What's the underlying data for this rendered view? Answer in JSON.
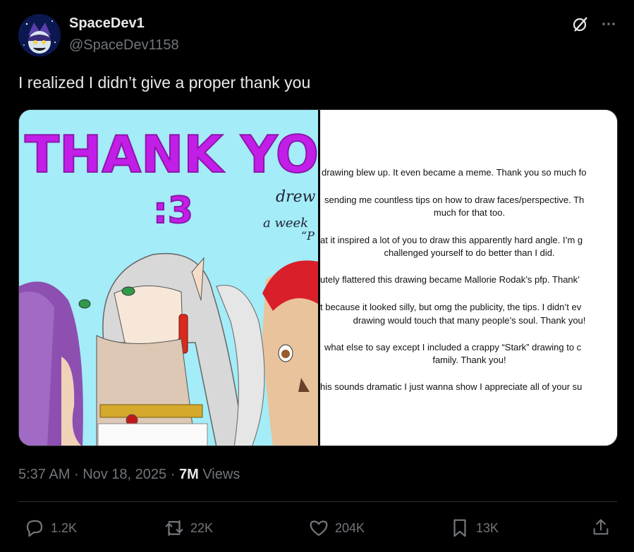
{
  "author": {
    "display_name": "SpaceDev1",
    "handle": "@SpaceDev1158"
  },
  "top_icons": [
    "grok-icon",
    "more-options-icon"
  ],
  "tweet": {
    "text": "I realized I didn’t give a proper thank you"
  },
  "media": {
    "left_image": {
      "heading_line1": "THANK YO",
      "heading_line2": ":3",
      "handwriting_1": "drew",
      "handwriting_2": "a week",
      "handwriting_3": "“P"
    },
    "right_note": {
      "lines": [
        "drawing blew up. It even became a meme. Thank you so much fo",
        "sending me countless tips on how to draw faces/perspective. Th",
        "much for that too.",
        "at it inspired a lot of you to draw this apparently hard angle. I’m g",
        "challenged yourself to do better than I did.",
        "utely flattered this drawing became Mallorie Rodak’s pfp. Thank’",
        "t because it looked silly, but omg the publicity, the tips. I didn’t ev",
        "drawing would touch that many people’s soul. Thank you!",
        "what else to say except I included a crappy “Stark” drawing to c",
        "family. Thank you!",
        "his sounds dramatic I just wanna show I appreciate all of your su"
      ]
    }
  },
  "meta": {
    "time": "5:37 AM",
    "sep1": "·",
    "date": "Nov 18, 2025",
    "sep2": "·",
    "views_count": "7M",
    "views_label": "Views"
  },
  "actions": {
    "replies": "1.2K",
    "reposts": "22K",
    "likes": "204K",
    "bookmarks": "13K"
  },
  "colors": {
    "background": "#000000",
    "text_primary": "#e7e9ea",
    "text_secondary": "#71767b",
    "border": "#2f3336",
    "thank_you_purple": "#c21ee8",
    "art_sky": "#a3ecf8"
  }
}
